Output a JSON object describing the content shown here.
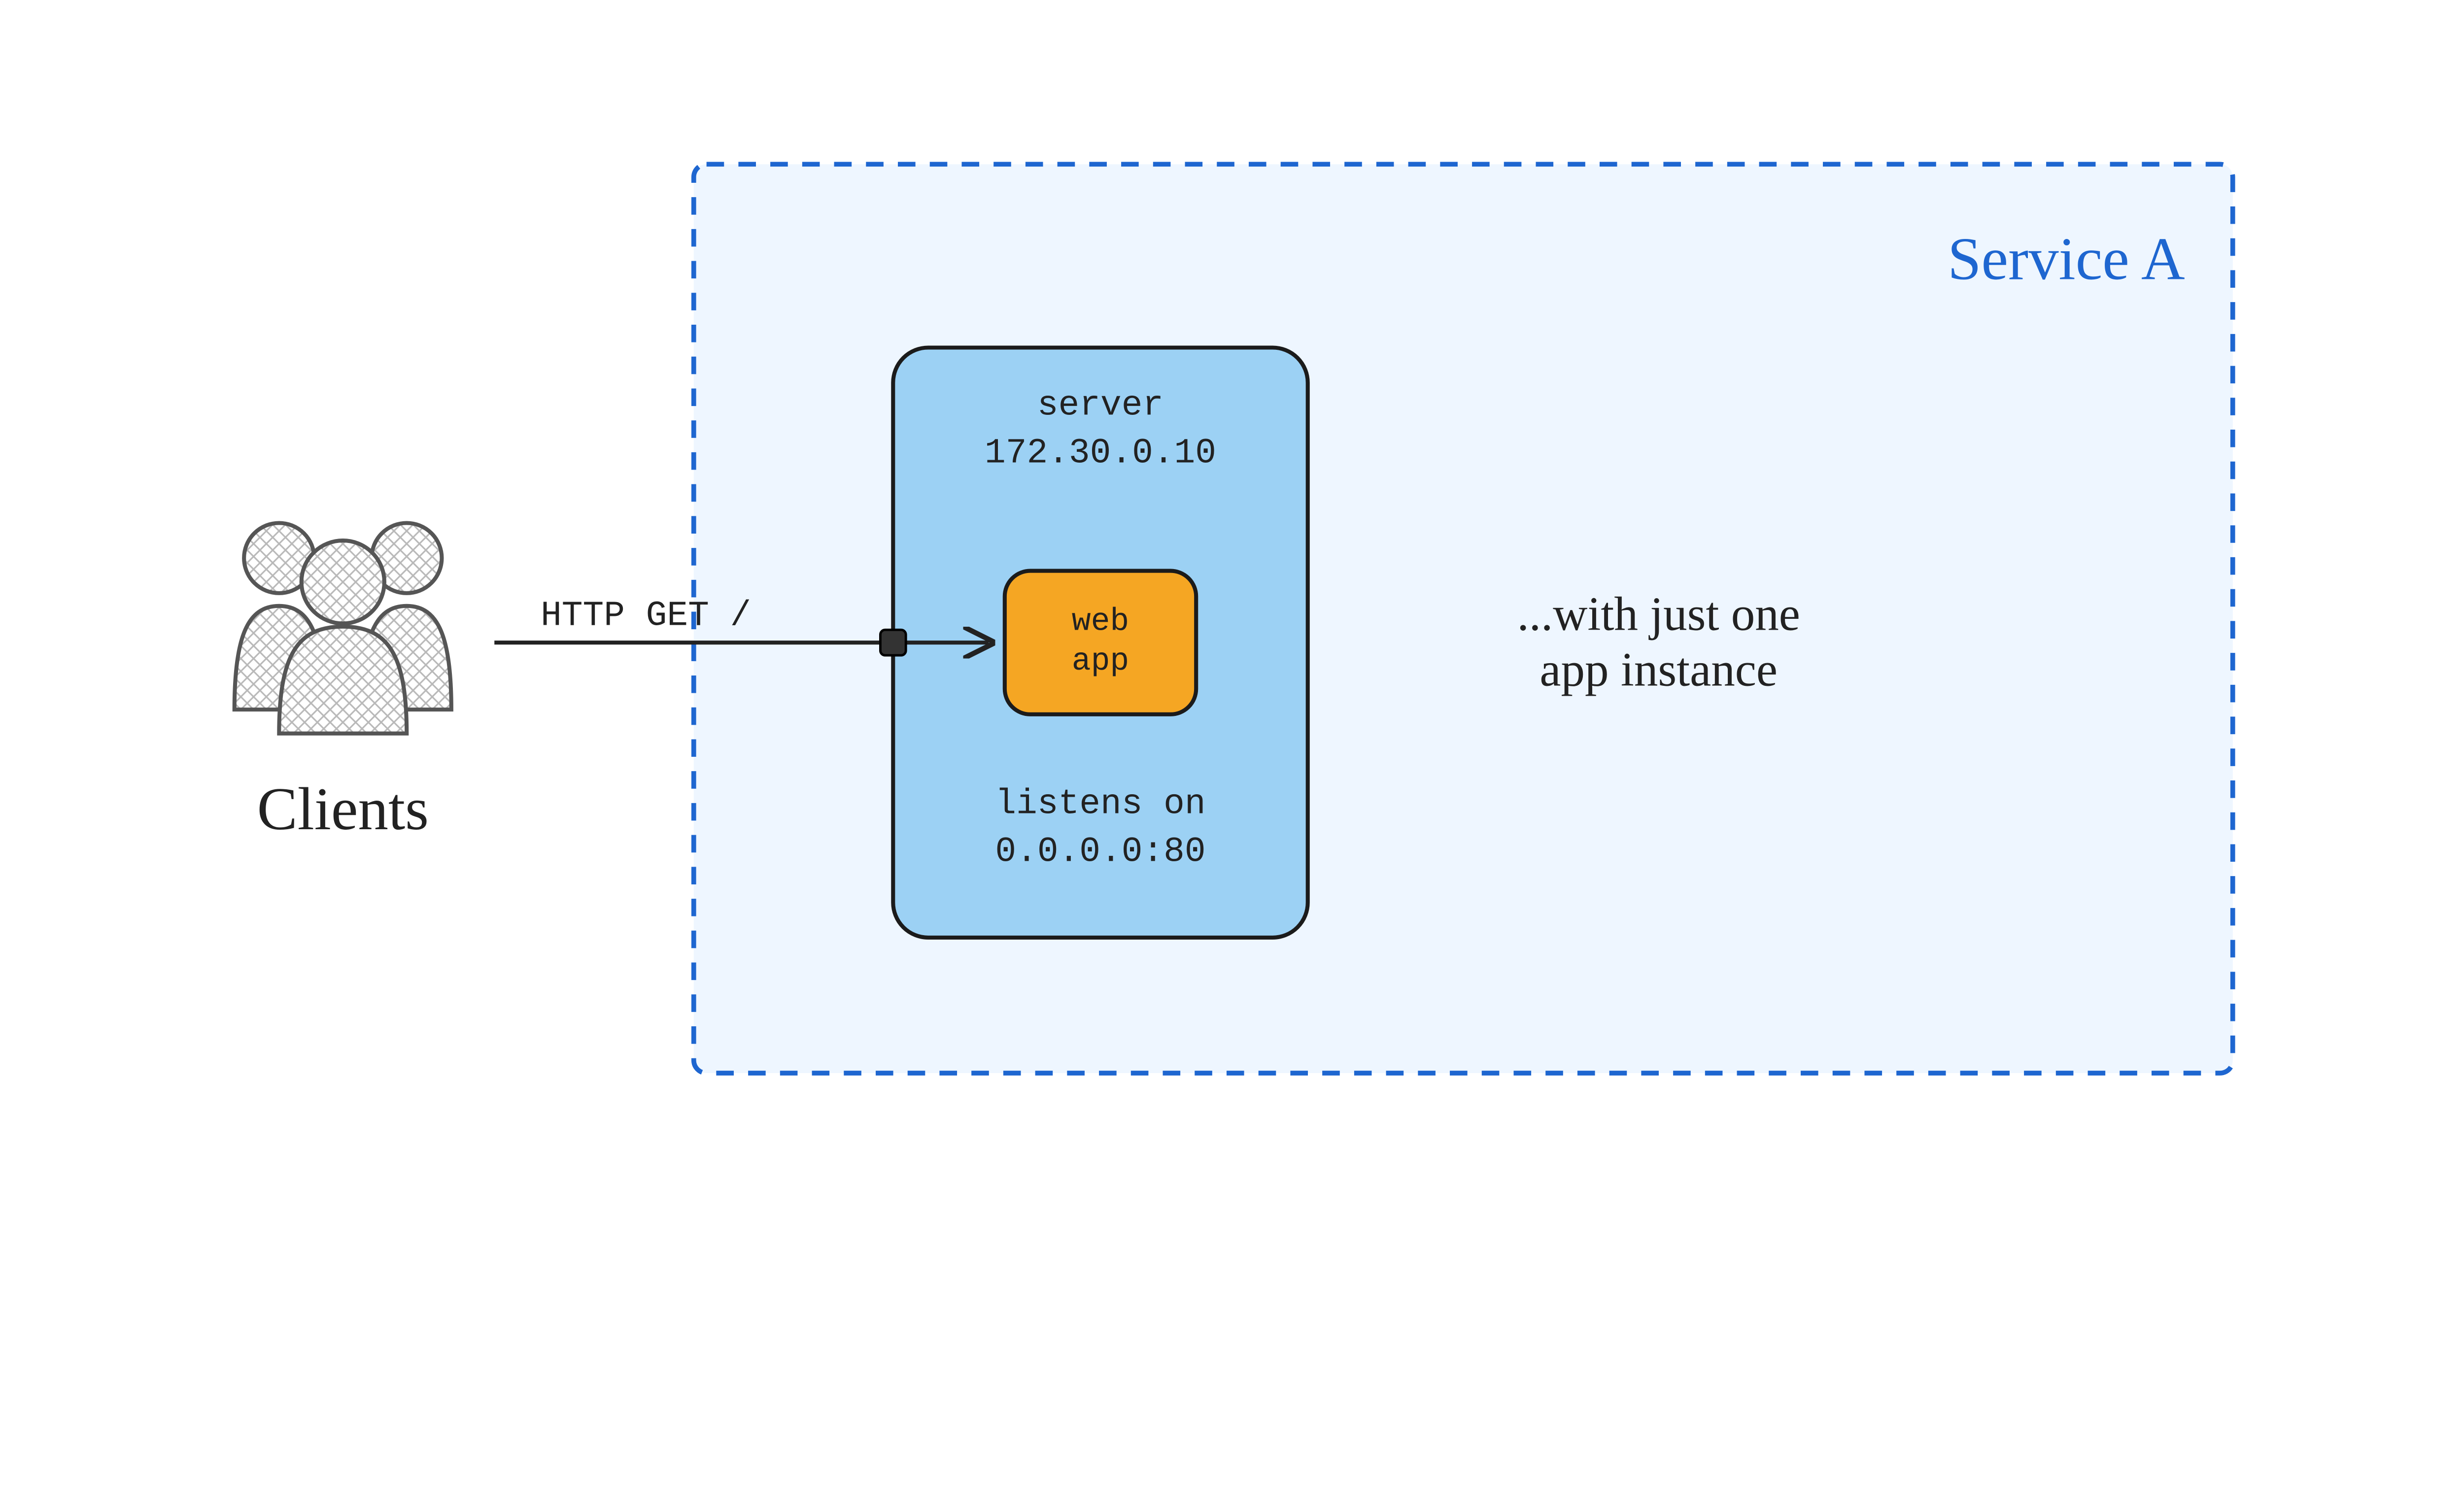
{
  "clients_label": "Clients",
  "http_label": "HTTP GET /",
  "service_title": "Service A",
  "server": {
    "title": "server",
    "ip": "172.30.0.10",
    "listens_l1": "listens on",
    "listens_l2": "0.0.0.0:80"
  },
  "webapp": {
    "l1": "web",
    "l2": "app"
  },
  "note": {
    "l1": "...with just one",
    "l2": "app instance"
  },
  "colors": {
    "service_stroke": "#1e66d0",
    "service_fill": "#eef6ff",
    "server_stroke": "#1b1b1b",
    "server_fill": "#9cd1f4",
    "webapp_stroke": "#1b1b1b",
    "webapp_fill": "#f5a623",
    "ink": "#222222"
  }
}
